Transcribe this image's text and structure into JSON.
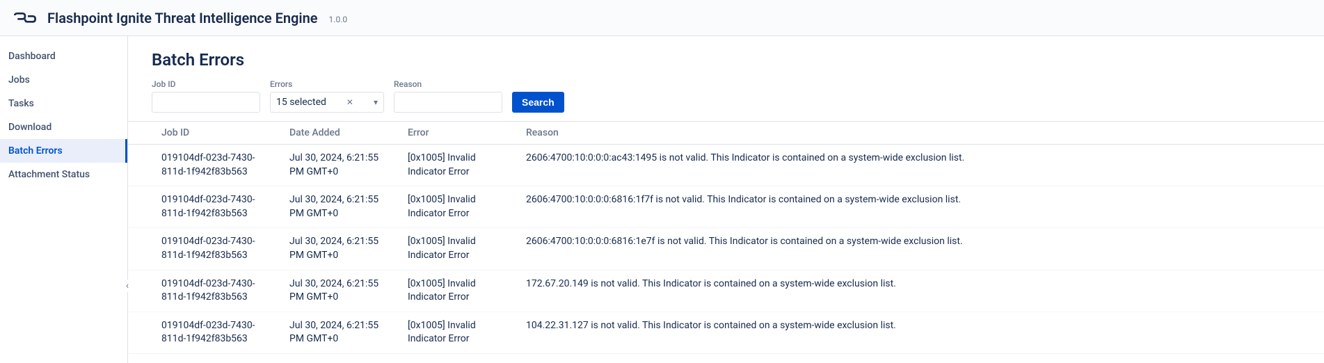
{
  "header": {
    "title": "Flashpoint Ignite Threat Intelligence Engine",
    "version": "1.0.0"
  },
  "sidebar": {
    "items": [
      {
        "label": "Dashboard",
        "active": false
      },
      {
        "label": "Jobs",
        "active": false
      },
      {
        "label": "Tasks",
        "active": false
      },
      {
        "label": "Download",
        "active": false
      },
      {
        "label": "Batch Errors",
        "active": true
      },
      {
        "label": "Attachment Status",
        "active": false
      }
    ]
  },
  "page": {
    "title": "Batch Errors"
  },
  "filters": {
    "job_id": {
      "label": "Job ID",
      "value": ""
    },
    "errors": {
      "label": "Errors",
      "selected_text": "15 selected"
    },
    "reason": {
      "label": "Reason",
      "value": ""
    },
    "search_label": "Search"
  },
  "table": {
    "columns": [
      "Job ID",
      "Date Added",
      "Error",
      "Reason"
    ],
    "rows": [
      {
        "job_id": "019104df-023d-7430-811d-1f942f83b563",
        "date_added": "Jul 30, 2024, 6:21:55 PM GMT+0",
        "error": "[0x1005] Invalid Indicator Error",
        "reason": "2606:4700:10:0:0:0:ac43:1495 is not valid. This Indicator is contained on a system-wide exclusion list."
      },
      {
        "job_id": "019104df-023d-7430-811d-1f942f83b563",
        "date_added": "Jul 30, 2024, 6:21:55 PM GMT+0",
        "error": "[0x1005] Invalid Indicator Error",
        "reason": "2606:4700:10:0:0:0:6816:1f7f is not valid. This Indicator is contained on a system-wide exclusion list."
      },
      {
        "job_id": "019104df-023d-7430-811d-1f942f83b563",
        "date_added": "Jul 30, 2024, 6:21:55 PM GMT+0",
        "error": "[0x1005] Invalid Indicator Error",
        "reason": "2606:4700:10:0:0:0:6816:1e7f is not valid. This Indicator is contained on a system-wide exclusion list."
      },
      {
        "job_id": "019104df-023d-7430-811d-1f942f83b563",
        "date_added": "Jul 30, 2024, 6:21:55 PM GMT+0",
        "error": "[0x1005] Invalid Indicator Error",
        "reason": "172.67.20.149 is not valid. This Indicator is contained on a system-wide exclusion list."
      },
      {
        "job_id": "019104df-023d-7430-811d-1f942f83b563",
        "date_added": "Jul 30, 2024, 6:21:55 PM GMT+0",
        "error": "[0x1005] Invalid Indicator Error",
        "reason": "104.22.31.127 is not valid. This Indicator is contained on a system-wide exclusion list."
      }
    ]
  }
}
